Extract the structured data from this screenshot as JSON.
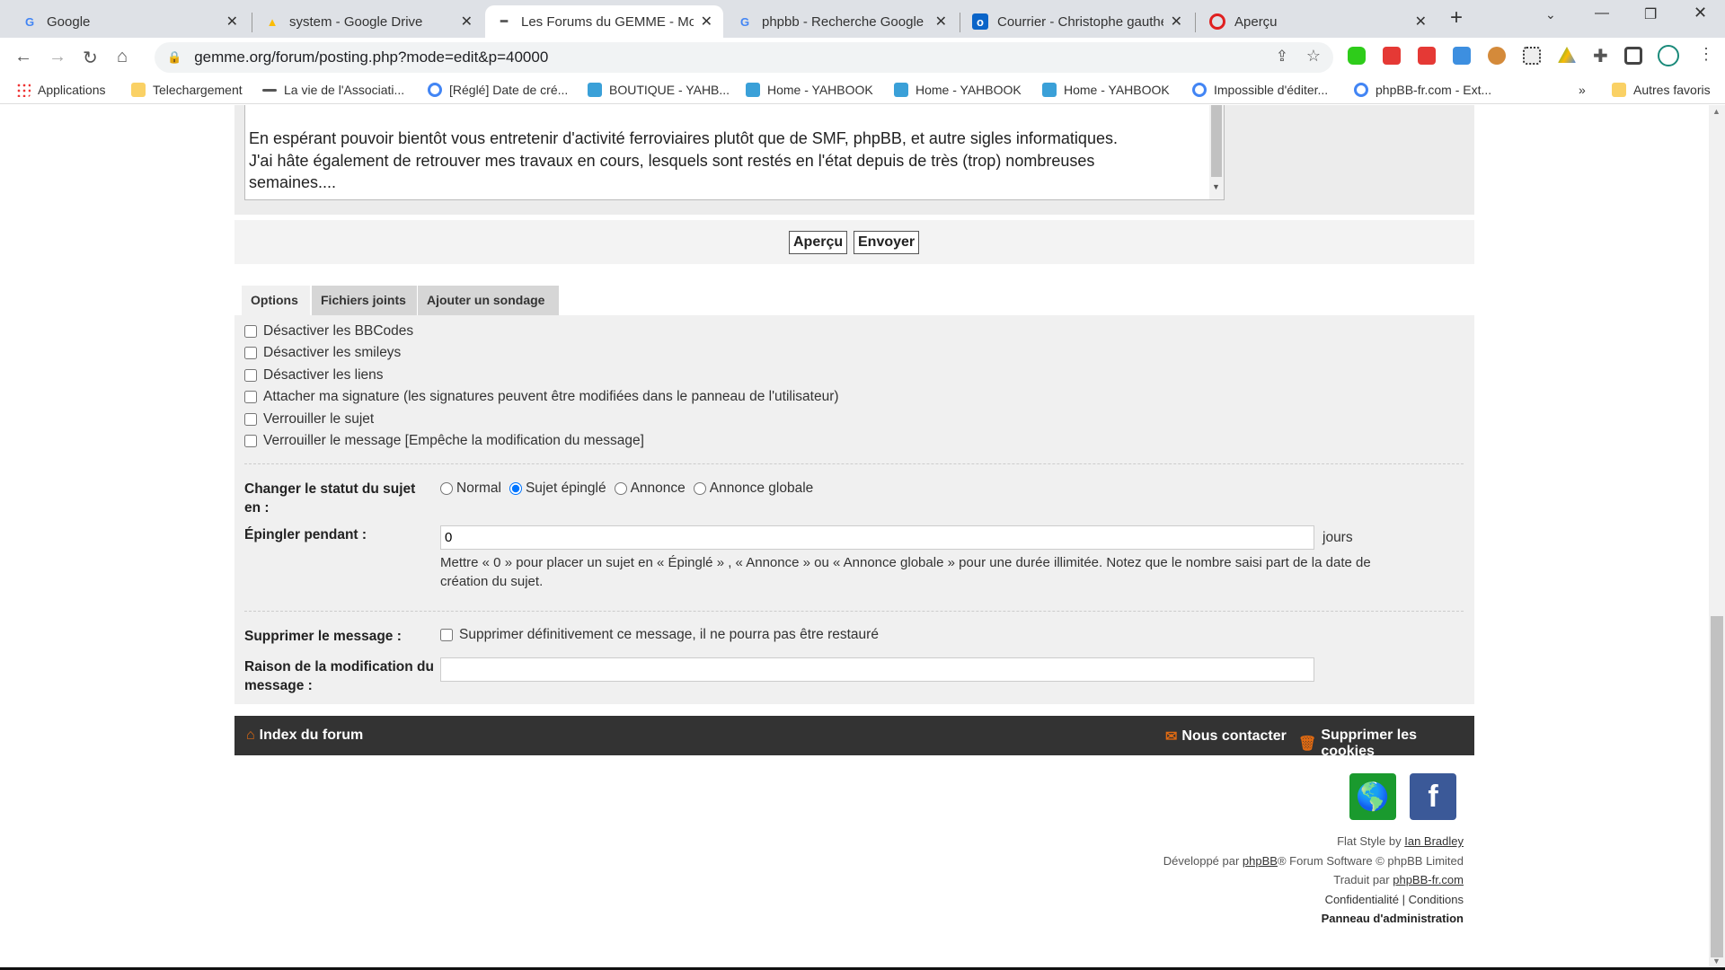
{
  "browser": {
    "tabs": [
      {
        "label": "Google",
        "icon": "google-icon",
        "active": false
      },
      {
        "label": "system - Google Drive",
        "icon": "google-drive-icon",
        "active": false
      },
      {
        "label": "Les Forums du GEMME - Modifier",
        "icon": "gemme-favicon",
        "active": true
      },
      {
        "label": "phpbb - Recherche Google",
        "icon": "google-icon",
        "active": false
      },
      {
        "label": "Courrier - Christophe gauthey",
        "icon": "outlook-icon",
        "active": false
      },
      {
        "label": "Aperçu",
        "icon": "opera-icon",
        "active": false
      }
    ],
    "new_tab": "+",
    "url": "gemme.org/forum/posting.php?mode=edit&p=40000",
    "bookmarks": [
      "Applications",
      "Telechargement",
      "La vie de l'Associati...",
      "[Réglé] Date de cré...",
      "BOUTIQUE - YAHB...",
      "Home - YAHBOOK",
      "Home - YAHBOOK",
      "Home - YAHBOOK",
      "Impossible d'éditer...",
      "phpBB-fr.com - Ext..."
    ],
    "bookmarks_more": "»",
    "other_bookmarks": "Autres favoris"
  },
  "editor": {
    "lines": [
      "En espérant pouvoir bientôt vous entretenir d'activité ferroviaires plutôt que de SMF, phpBB, et autre sigles informatiques.",
      "J'ai hâte également de retrouver mes travaux en cours, lesquels sont restés en l'état depuis de très (trop) nombreuses",
      "semaines...."
    ]
  },
  "buttons": {
    "preview": "Aperçu",
    "submit": "Envoyer"
  },
  "form_tabs": [
    "Options",
    "Fichiers joints",
    "Ajouter un sondage"
  ],
  "options": {
    "checkboxes": [
      {
        "label": "Désactiver les BBCodes",
        "checked": false
      },
      {
        "label": "Désactiver les smileys",
        "checked": false
      },
      {
        "label": "Désactiver les liens",
        "checked": false
      },
      {
        "label": "Attacher ma signature (les signatures peuvent être modifiées dans le panneau de l'utilisateur)",
        "checked": false
      },
      {
        "label": "Verrouiller le sujet",
        "checked": false
      },
      {
        "label": "Verrouiller le message [Empêche la modification du message]",
        "checked": false
      }
    ],
    "status_label_1": "Changer le statut du sujet",
    "status_label_2": "en :",
    "status_options": [
      "Normal",
      "Sujet épinglé",
      "Annonce",
      "Annonce globale"
    ],
    "status_selected": "Sujet épinglé",
    "pin_label": "Épingler pendant :",
    "pin_value": "0",
    "pin_unit": "jours",
    "pin_help_1": "Mettre « 0 » pour placer un sujet en « Épinglé » , « Annonce » ou « Annonce globale » pour une durée illimitée. Notez que le nombre saisi part de la date de",
    "pin_help_2": "création du sujet.",
    "delete_label": "Supprimer le message :",
    "delete_checkbox": "Supprimer définitivement ce message, il ne pourra pas être restauré",
    "reason_label_1": "Raison de la modification du",
    "reason_label_2": "message :",
    "reason_value": ""
  },
  "footer": {
    "index": "Index du forum",
    "contact": "Nous contacter",
    "cookies": "Supprimer les cookies",
    "style_prefix": "Flat Style by ",
    "style_author": "Ian Bradley",
    "dev_prefix": "Développé par ",
    "dev_link": "phpBB",
    "dev_suffix": "® Forum Software © phpBB Limited",
    "trans_prefix": "Traduit par ",
    "trans_link": "phpBB-fr.com",
    "privacy": "Confidentialité",
    "pipe": " | ",
    "terms": "Conditions",
    "admin": "Panneau d'administration"
  },
  "colors": {
    "accent": "#e06a12",
    "footer_bg": "#333333",
    "globe": "#1a9a2e",
    "facebook": "#3b5998"
  }
}
